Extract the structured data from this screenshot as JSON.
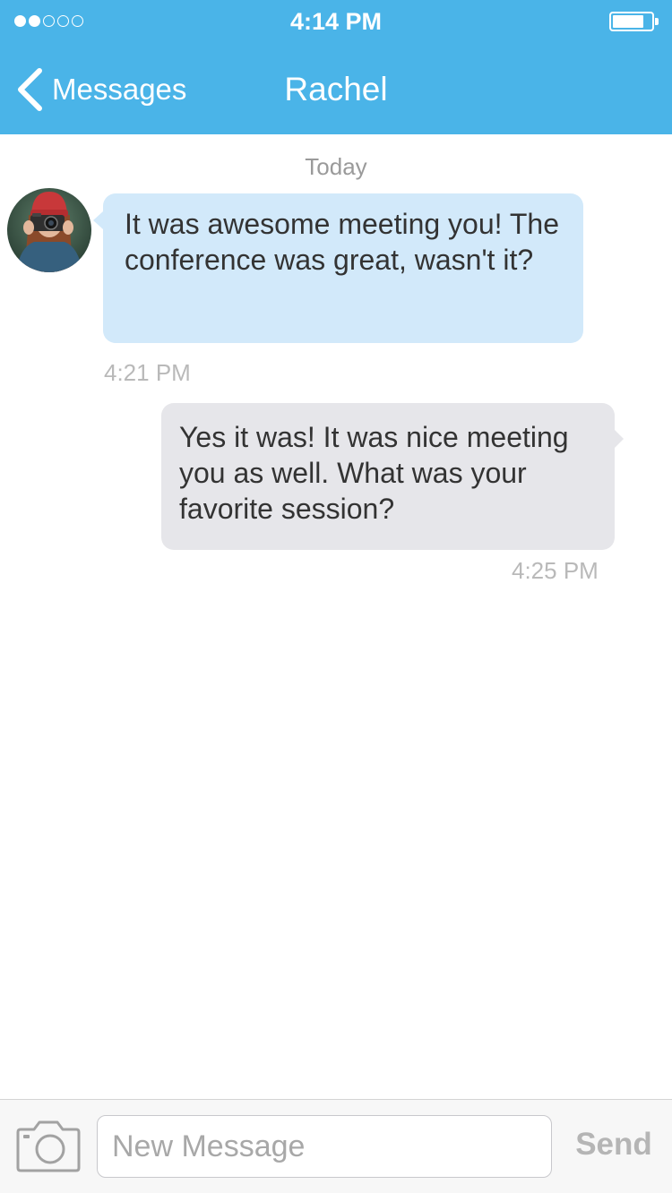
{
  "status_bar": {
    "time": "4:14 PM",
    "signal_icon": "signal-dots-icon",
    "signal_strength_filled": 2,
    "signal_strength_total": 5,
    "battery_icon": "battery-icon"
  },
  "nav": {
    "back_icon": "chevron-left-icon",
    "back_label": "Messages",
    "title": "Rachel"
  },
  "conversation": {
    "date_divider": "Today",
    "messages": [
      {
        "direction": "incoming",
        "text": "It was awesome meeting you! The conference was great, wasn't it?",
        "time": "4:21 PM"
      },
      {
        "direction": "outgoing",
        "text": "Yes it was! It was nice meeting you as well. What was your favorite session?",
        "time": "4:25 PM"
      }
    ]
  },
  "input_bar": {
    "camera_icon": "camera-icon",
    "placeholder": "New Message",
    "value": "",
    "send_label": "Send"
  },
  "colors": {
    "header_bg": "#4ab4e8",
    "incoming_bubble": "#d2e9fa",
    "outgoing_bubble": "#e6e6ea",
    "timestamp": "#b9b9b9",
    "send_disabled": "#b5b5b5"
  }
}
